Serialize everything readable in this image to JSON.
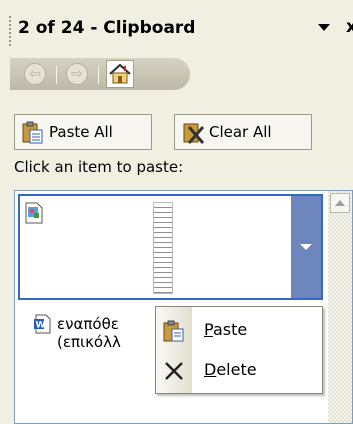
{
  "panel": {
    "title": "2 of 24 - Clipboard",
    "close_glyph": "x"
  },
  "nav": {
    "back_icon": "back-arrow-icon",
    "forward_icon": "forward-arrow-icon",
    "home_icon": "home-icon"
  },
  "actions": {
    "paste_all_label": "Paste All",
    "clear_all_label": "Clear All"
  },
  "hint": "Click an item to paste:",
  "items": [
    {
      "type": "image",
      "icon": "picture-document-icon",
      "selected": true
    },
    {
      "type": "text",
      "icon": "word-document-icon",
      "text_line1": "εναπόθε",
      "text_line2": "(επικόλλ"
    }
  ],
  "context_menu": {
    "paste_label": "Paste",
    "paste_accel": "P",
    "delete_label": "Delete",
    "delete_accel": "D"
  },
  "colors": {
    "panel_bg": "#f1efe2",
    "selection_border": "#316ac5",
    "dropdown_bg": "#6d86bd"
  }
}
